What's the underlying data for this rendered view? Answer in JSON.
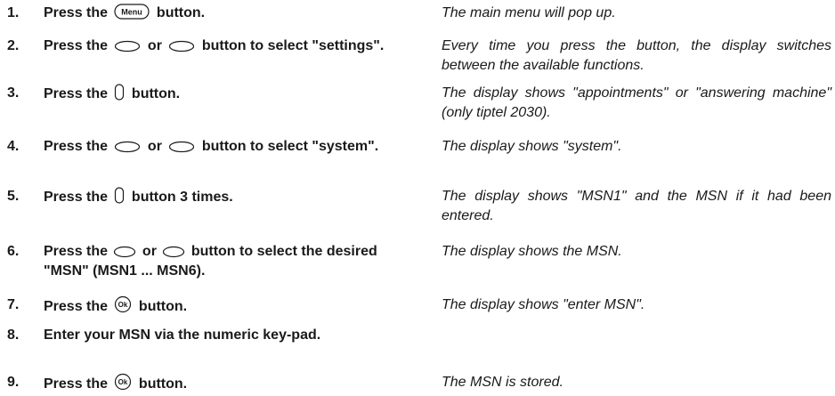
{
  "steps": [
    {
      "num": "1.",
      "pre": "Press the",
      "icon": "menu-button-icon",
      "icon_label": "Menu",
      "post": "button.",
      "result": "The main menu will pop up."
    },
    {
      "num": "2.",
      "pre": "Press the",
      "icon": "oval-button-icon",
      "mid": "or",
      "post": "button to select \"settings\".",
      "result": "Every time you press the button, the display switches between the available functions."
    },
    {
      "num": "3.",
      "pre": "Press the",
      "icon": "vertical-button-icon",
      "post": "button.",
      "result": "The display shows \"appointments\" or \"answering machine\" (only tiptel 2030)."
    },
    {
      "num": "4.",
      "pre": "Press the",
      "icon": "oval-button-icon",
      "mid": "or",
      "post": "button to select \"system\".",
      "result": "The display shows \"system\"."
    },
    {
      "num": "5.",
      "pre": "Press the",
      "icon": "vertical-button-icon",
      "post": "button 3 times.",
      "result": "The display shows \"MSN1\" and the MSN if it had been entered."
    },
    {
      "num": "6.",
      "pre": "Press the",
      "icon": "oval-button-icon",
      "mid": "or",
      "post": "button to select the desired \"MSN\" (MSN1 ... MSN6).",
      "result": "The display shows the MSN."
    },
    {
      "num": "7.",
      "pre": "Press the",
      "icon": "ok-button-icon",
      "icon_label": "Ok",
      "post": "button.",
      "result": "The display shows \"enter MSN\"."
    },
    {
      "num": "8.",
      "text": "Enter your MSN via the numeric key-pad.",
      "result": ""
    },
    {
      "num": "9.",
      "pre": "Press the",
      "icon": "ok-button-icon",
      "icon_label": "Ok",
      "post": "button.",
      "result": "The MSN is stored."
    }
  ]
}
